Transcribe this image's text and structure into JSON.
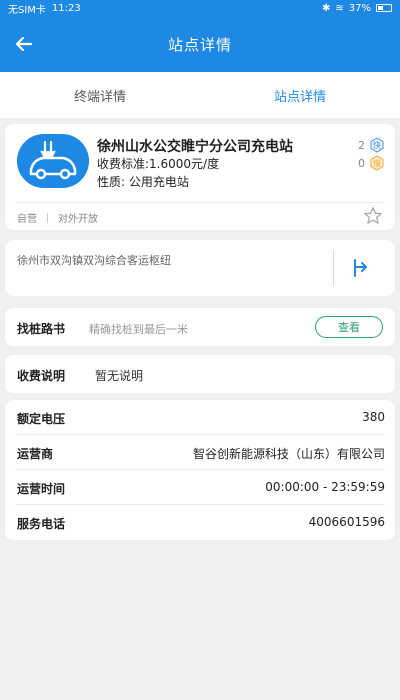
{
  "status_bar": {
    "carrier": "无SIM卡",
    "time": "11:23",
    "battery_percent": "37%"
  },
  "header": {
    "title": "站点详情"
  },
  "tabs": [
    {
      "label": "终端详情",
      "active": false
    },
    {
      "label": "站点详情",
      "active": true
    }
  ],
  "station": {
    "name": "徐州山水公交睢宁分公司充电站",
    "fee": "收费标准:1.6000元/度",
    "nature": "性质: 公用充电站",
    "fast_count": "2",
    "fast_label": "快",
    "slow_count": "0",
    "slow_label": "慢",
    "tags": [
      "自营",
      "对外开放"
    ]
  },
  "address": {
    "text": "徐州市双沟镇双沟综合客运枢纽"
  },
  "route": {
    "label": "找桩路书",
    "hint": "精确找桩到最后一米",
    "button": "查看"
  },
  "fee_note": {
    "label": "收费说明",
    "value": "暂无说明"
  },
  "info": [
    {
      "label": "额定电压",
      "value": "380"
    },
    {
      "label": "运营商",
      "value": "智谷创新能源科技（山东）有限公司"
    },
    {
      "label": "运营时间",
      "value": "00:00:00 - 23:59:59"
    },
    {
      "label": "服务电话",
      "value": "4006601596"
    }
  ],
  "colors": {
    "primary": "#1e88e5",
    "view_button": "#2aa37a",
    "fast_icon": "#4a90e2",
    "slow_icon": "#f5a623"
  }
}
